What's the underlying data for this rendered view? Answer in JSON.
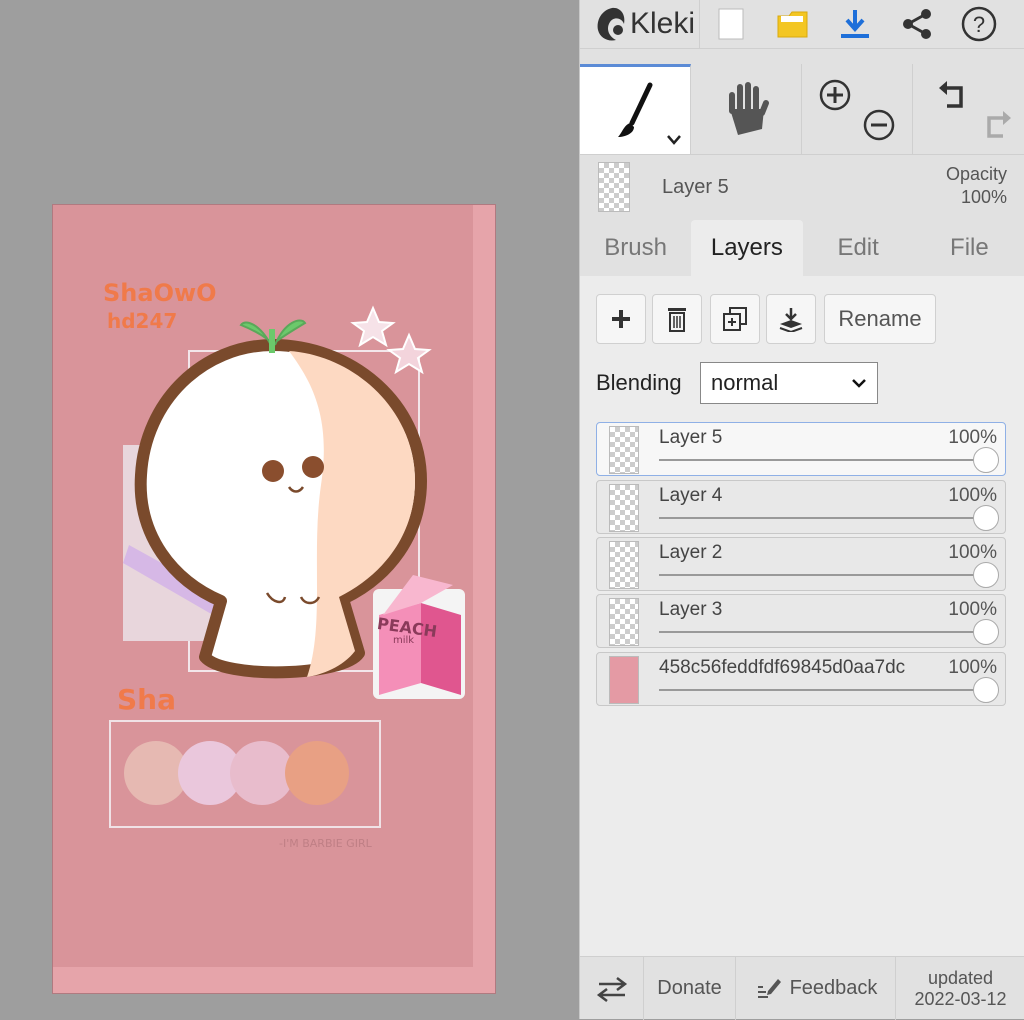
{
  "app": {
    "name": "Kleki"
  },
  "artwork": {
    "name_line1": "ShaOwO",
    "name_line2": "hd247",
    "short_name": "Sha",
    "milk_label1": "PEACH",
    "milk_label2": "milk",
    "caption": "-I'M BARBIE GIRL"
  },
  "current_layer": {
    "name": "Layer 5",
    "opacity_label": "Opacity",
    "opacity_value": "100%"
  },
  "tabs": [
    {
      "label": "Brush"
    },
    {
      "label": "Layers"
    },
    {
      "label": "Edit"
    },
    {
      "label": "File"
    }
  ],
  "layers_panel": {
    "rename_label": "Rename",
    "blending_label": "Blending",
    "blending_value": "normal",
    "layers": [
      {
        "name": "Layer 5",
        "opacity": "100%",
        "opacity_fraction": 1.0,
        "selected": true
      },
      {
        "name": "Layer 4",
        "opacity": "100%",
        "opacity_fraction": 1.0,
        "selected": false
      },
      {
        "name": "Layer 2",
        "opacity": "100%",
        "opacity_fraction": 1.0,
        "selected": false
      },
      {
        "name": "Layer 3",
        "opacity": "100%",
        "opacity_fraction": 1.0,
        "selected": false
      },
      {
        "name": "458c56feddfdf69845d0aa7dc",
        "opacity": "100%",
        "opacity_fraction": 1.0,
        "selected": false
      }
    ]
  },
  "footer": {
    "donate_label": "Donate",
    "feedback_label": "Feedback",
    "updated_line1": "updated",
    "updated_line2": "2022-03-12"
  },
  "colors": {
    "accent": "#5b8bd6",
    "download": "#1e6fd9",
    "folder": "#f3c623",
    "canvas_bg": "#d9949a"
  }
}
